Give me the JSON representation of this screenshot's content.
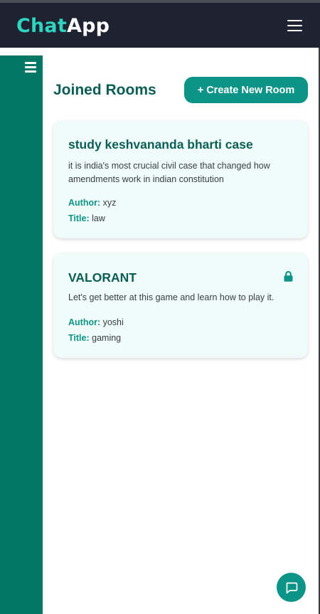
{
  "header": {
    "brand_part1": "Chat",
    "brand_part2": "App",
    "menu_icon": "hamburger-icon"
  },
  "sidebar": {
    "menu_icon": "hamburger-icon"
  },
  "main": {
    "heading": "Joined Rooms",
    "create_button_label": "+ Create New Room",
    "rooms": [
      {
        "name": "study keshvananda bharti case",
        "description": "it is india's most crucial civil case that changed how amendments work in indian constitution",
        "author_label": "Author:",
        "author": "xyz",
        "title_label": "Title:",
        "title": "law",
        "locked": false
      },
      {
        "name": "VALORANT",
        "description": "Let's get better at this game and learn how to play it.",
        "author_label": "Author:",
        "author": "yoshi",
        "title_label": "Title:",
        "title": "gaming",
        "locked": true,
        "lock_icon": "lock-icon"
      }
    ]
  },
  "fab": {
    "icon": "chat-bubble-icon"
  },
  "colors": {
    "topbar": "#1f2231",
    "brand_accent": "#2dd4bf",
    "sidebar": "#037766",
    "primary": "#0d9488",
    "heading": "#0b5e55",
    "card_bg": "#effcf9"
  }
}
